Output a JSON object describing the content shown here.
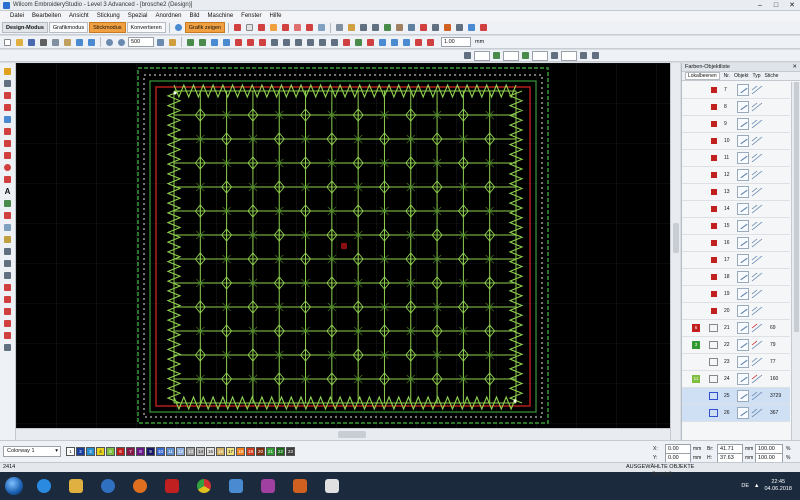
{
  "window": {
    "title": "Wilcom EmbroideryStudio - Level 3 Advanced - [brosche2 (Design)]"
  },
  "menu": [
    "Datei",
    "Bearbeiten",
    "Ansicht",
    "Stickung",
    "Spezial",
    "Anordnen",
    "Bild",
    "Maschine",
    "Fenster",
    "Hilfe"
  ],
  "modes": {
    "design": "Design-Modus",
    "grafik": "Grafikmodus",
    "stick": "Stickmodus",
    "konvert": "Konvertieren",
    "grafik_zeigen": "Grafik zeigen"
  },
  "toolbar": {
    "zoom": "500",
    "scale": "1.00",
    "unit": "mm"
  },
  "panel": {
    "title": "Farben-Objektliste",
    "cols": {
      "tab": "Lokalbeenen",
      "nr": "Nr.",
      "obj": "Objekt",
      "typ": "Typ",
      "stiche": "Stiche"
    },
    "rows": [
      {
        "nr": "7",
        "stiche": "",
        "kind": "obj"
      },
      {
        "nr": "8",
        "stiche": "",
        "kind": "obj"
      },
      {
        "nr": "9",
        "stiche": "",
        "kind": "obj"
      },
      {
        "nr": "10",
        "stiche": "",
        "kind": "obj"
      },
      {
        "nr": "11",
        "stiche": "",
        "kind": "obj"
      },
      {
        "nr": "12",
        "stiche": "",
        "kind": "obj"
      },
      {
        "nr": "13",
        "stiche": "",
        "kind": "obj"
      },
      {
        "nr": "14",
        "stiche": "",
        "kind": "obj"
      },
      {
        "nr": "15",
        "stiche": "",
        "kind": "obj"
      },
      {
        "nr": "16",
        "stiche": "",
        "kind": "obj"
      },
      {
        "nr": "17",
        "stiche": "",
        "kind": "obj"
      },
      {
        "nr": "18",
        "stiche": "",
        "kind": "obj"
      },
      {
        "nr": "19",
        "stiche": "",
        "kind": "obj"
      },
      {
        "nr": "20",
        "stiche": "",
        "kind": "obj"
      },
      {
        "nr": "21",
        "stiche": "69",
        "kind": "grp",
        "grp": "6",
        "grpcolor": "#c0201e"
      },
      {
        "nr": "22",
        "stiche": "79",
        "kind": "grp",
        "grp": "3",
        "grpcolor": "#2f9a2f"
      },
      {
        "nr": "23",
        "stiche": "77",
        "kind": "out"
      },
      {
        "nr": "24",
        "stiche": "160",
        "kind": "grp",
        "grp": "11",
        "grpcolor": "#7fbf3f"
      },
      {
        "nr": "25",
        "stiche": "3729",
        "kind": "sel"
      },
      {
        "nr": "26",
        "stiche": "367",
        "kind": "sel"
      }
    ]
  },
  "status": {
    "colorway": "Colorway 1",
    "swatches": [
      "1",
      "2",
      "3",
      "4",
      "5",
      "6",
      "7",
      "8",
      "9",
      "10",
      "11",
      "12",
      "13",
      "14",
      "15",
      "16",
      "17",
      "18",
      "19",
      "20",
      "21",
      "22",
      "23"
    ],
    "swatch_colors": [
      "#ffffff",
      "#1a3fa0",
      "#2a8fd0",
      "#e6d21a",
      "#7fbf3f",
      "#c0201e",
      "#8a1a4a",
      "#6a1a8a",
      "#1a1a6a",
      "#3a6ad0",
      "#6090d0",
      "#90b0e0",
      "#a0a0a0",
      "#c0c0c0",
      "#e0e0e0",
      "#d0b060",
      "#f0e080",
      "#f08020",
      "#d04020",
      "#803010",
      "#2f9a2f",
      "#1a6a1a",
      "#404040"
    ],
    "x_label": "X:",
    "x_val": "0.00",
    "y_label": "Y:",
    "y_val": "0.00",
    "mm": "mm",
    "br_label": "Br:",
    "br_val": "41.71",
    "h_label": "H:",
    "h_val": "37.63",
    "pct1": "100.00",
    "pct2": "100.00",
    "pct": "%"
  },
  "info": {
    "stitches": "2414",
    "selected": "AUSGEWÄHLTE OBJEKTE",
    "used": "(benutzt)"
  },
  "taskbar": {
    "lang": "DE",
    "time": "22:45",
    "date": "04.06.2018"
  }
}
